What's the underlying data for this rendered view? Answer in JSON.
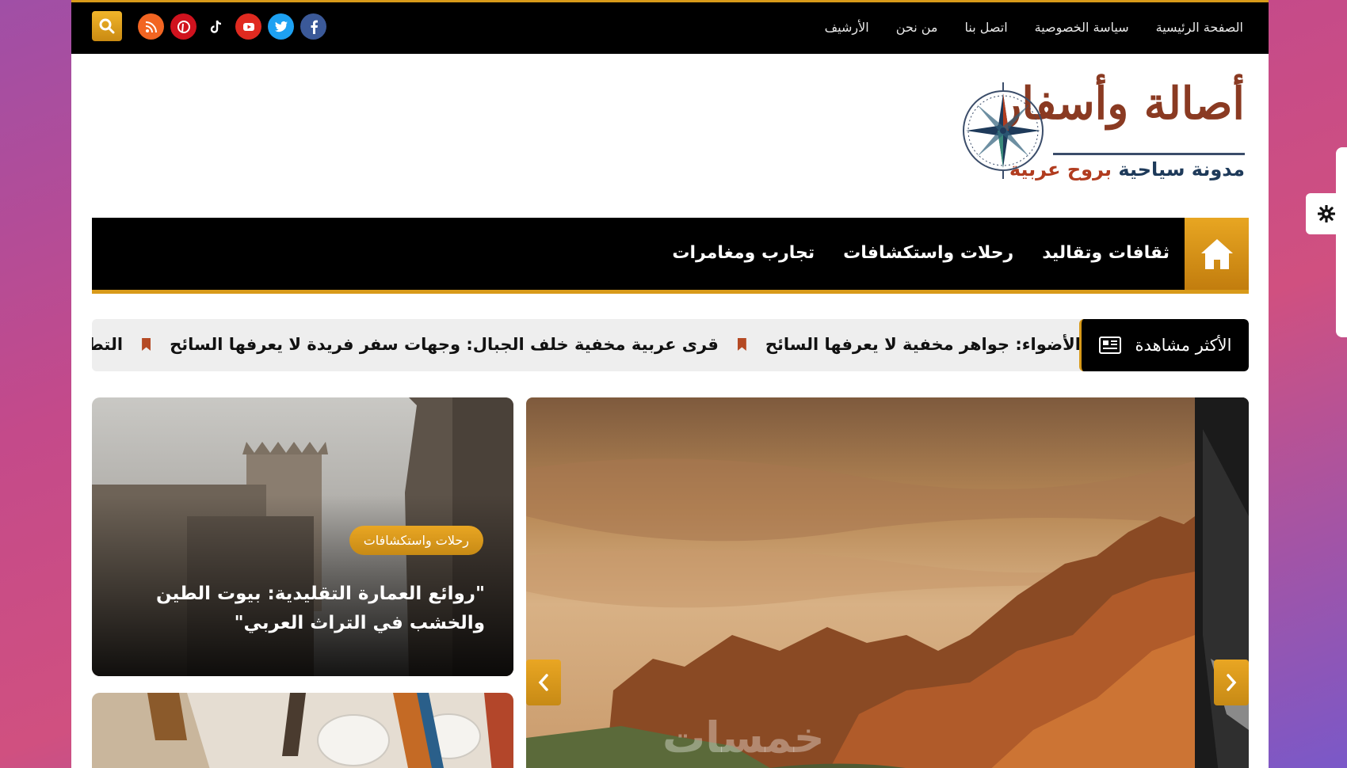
{
  "top_nav": {
    "items": [
      "الصفحة الرئيسية",
      "سياسة الخصوصية",
      "اتصل بنا",
      "من نحن",
      "الأرشيف"
    ]
  },
  "social_icons": [
    "facebook-icon",
    "twitter-icon",
    "youtube-icon",
    "tiktok-icon",
    "pinterest-icon",
    "rss-icon"
  ],
  "logo": {
    "title": "أصالة وأسفار",
    "subtitle_part1": "مدونة سياحية",
    "subtitle_part2": "بروح عربية"
  },
  "main_nav": {
    "items": [
      "ثقافات وتقاليد",
      "رحلات واستكشافات",
      "تجارب ومغامرات"
    ]
  },
  "ticker": {
    "label": "الأكثر مشاهدة",
    "items": [
      "الأضواء: جواهر مخفية لا يعرفها السائح",
      "قرى عربية مخفية خلف الجبال: وجهات سفر فريدة لا يعرفها السائح",
      "التطوع التراثي: كيف تحافظ"
    ]
  },
  "featured_left": {
    "category": "رحلات واستكشافات",
    "title": "\"روائع العمارة التقليدية: بيوت الطين والخشب في التراث العربي\""
  },
  "watermark": "خمسات",
  "colors": {
    "accent": "#d89a1a",
    "topbar": "#000000",
    "facebook": "#3b5998",
    "twitter": "#1da1f2",
    "youtube": "#e02a20",
    "pinterest": "#d0121e",
    "rss": "#f26522"
  }
}
